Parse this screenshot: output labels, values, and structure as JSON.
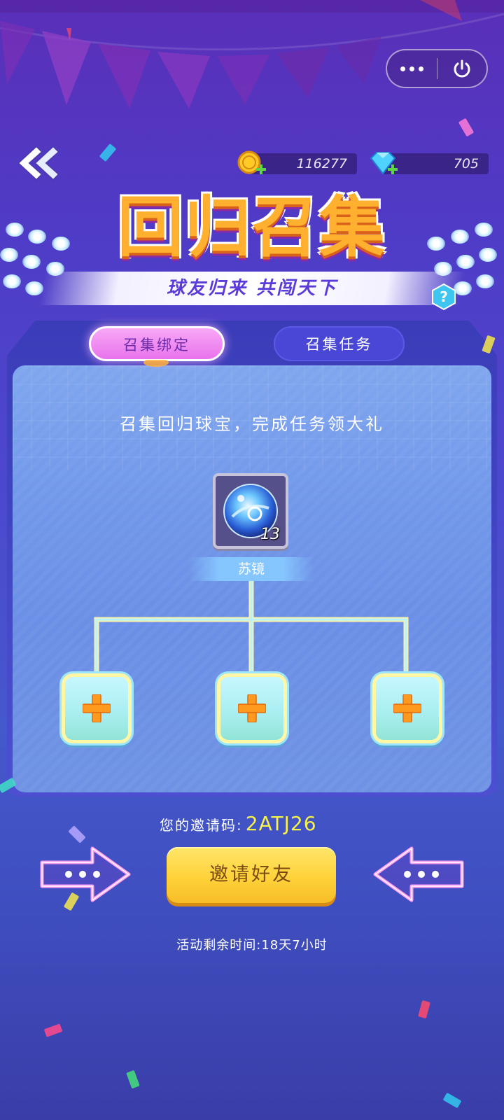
{
  "header": {
    "currency": {
      "coins": "116277",
      "gems": "705"
    }
  },
  "banner": {
    "title": "回归召集",
    "subtitle": "球友归来  共闯天下"
  },
  "tabs": [
    {
      "label": "召集绑定",
      "active": true
    },
    {
      "label": "召集任务",
      "active": false
    }
  ],
  "panel": {
    "caption": "召集回归球宝，完成任务领大礼",
    "reward": {
      "name": "苏镜",
      "count": "13"
    }
  },
  "invite": {
    "label": "您的邀请码:",
    "code": "2ATJ26",
    "button_label": "邀请好友",
    "remaining_time": "活动剩余时间:18天7小时"
  },
  "colors": {
    "accent_yellow": "#ffd23a",
    "tab_active": "#e873ec",
    "tab_inactive": "#4a47d6",
    "code_color": "#f6f04a"
  }
}
